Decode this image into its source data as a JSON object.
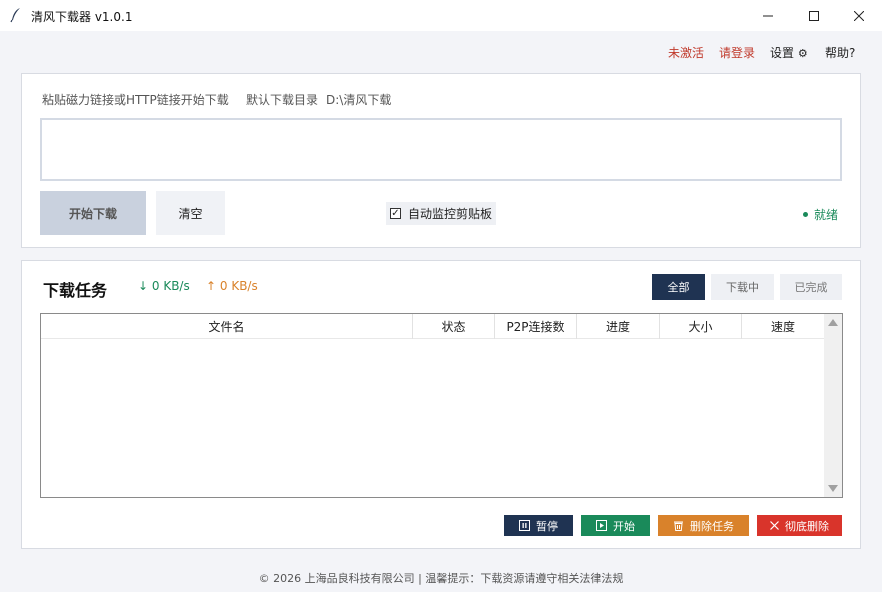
{
  "window": {
    "title": "清风下载器 v1.0.1",
    "icon": "feather-icon"
  },
  "topnav": {
    "unactivated": "未激活",
    "login": "请登录",
    "settings": "设置",
    "help": "帮助?"
  },
  "input_panel": {
    "hint": "粘贴磁力链接或HTTP链接开始下载",
    "default_dir_label": "默认下载目录",
    "default_dir_value": "D:\\清风下载",
    "link_input_value": "",
    "start_button": "开始下载",
    "clear_button": "清空",
    "monitor_clipboard_label": "自动监控剪贴板",
    "monitor_clipboard_checked": true,
    "status": "就绪"
  },
  "tasks_panel": {
    "title": "下载任务",
    "download_speed": "↓ 0 KB/s",
    "upload_speed": "↑ 0 KB/s",
    "filters": [
      "全部",
      "下载中",
      "已完成"
    ],
    "active_filter": "全部",
    "columns": [
      "文件名",
      "状态",
      "P2P连接数",
      "进度",
      "大小",
      "速度"
    ],
    "rows": [],
    "actions": {
      "pause": "暂停",
      "start": "开始",
      "delete": "删除任务",
      "purge": "彻底删除"
    }
  },
  "footer": "© 2026 上海品良科技有限公司 | 温馨提示：下载资源请遵守相关法律法规",
  "colors": {
    "navy": "#1f3352",
    "green": "#1a8a5a",
    "orange": "#d9822b",
    "red": "#d9342b",
    "alert": "#c0392b"
  }
}
